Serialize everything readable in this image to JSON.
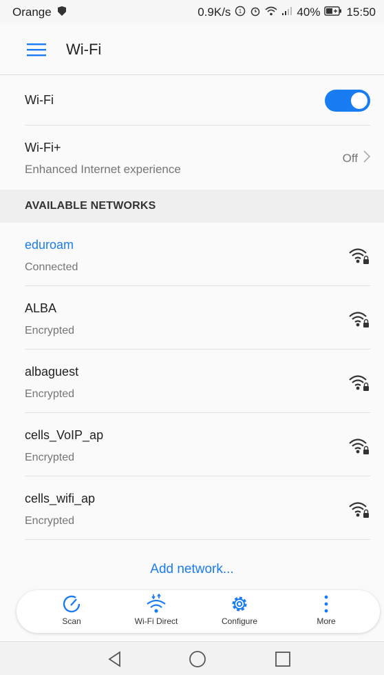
{
  "status_bar": {
    "carrier": "Orange",
    "speed": "0.9K/s",
    "battery": "40%",
    "time": "15:50"
  },
  "app_bar": {
    "title": "Wi-Fi"
  },
  "wifi_toggle": {
    "label": "Wi-Fi",
    "enabled": true
  },
  "wifi_plus": {
    "title": "Wi-Fi+",
    "subtitle": "Enhanced Internet experience",
    "value": "Off"
  },
  "section_header": "AVAILABLE NETWORKS",
  "networks": [
    {
      "name": "eduroam",
      "status": "Connected",
      "icon": "wifi-lock-icon"
    },
    {
      "name": "ALBA",
      "status": "Encrypted",
      "icon": "wifi-lock-icon"
    },
    {
      "name": "albaguest",
      "status": "Encrypted",
      "icon": "wifi-lock-icon"
    },
    {
      "name": "cells_VoIP_ap",
      "status": "Encrypted",
      "icon": "wifi-lock-icon"
    },
    {
      "name": "cells_wifi_ap",
      "status": "Encrypted",
      "icon": "wifi-lock-icon"
    }
  ],
  "add_network": "Add network...",
  "toolbar": {
    "scan": "Scan",
    "wifi_direct": "Wi-Fi Direct",
    "configure": "Configure",
    "more": "More"
  },
  "colors": {
    "accent": "#1a7cf2",
    "connected": "#1a7cf2",
    "subtext": "#757575"
  }
}
